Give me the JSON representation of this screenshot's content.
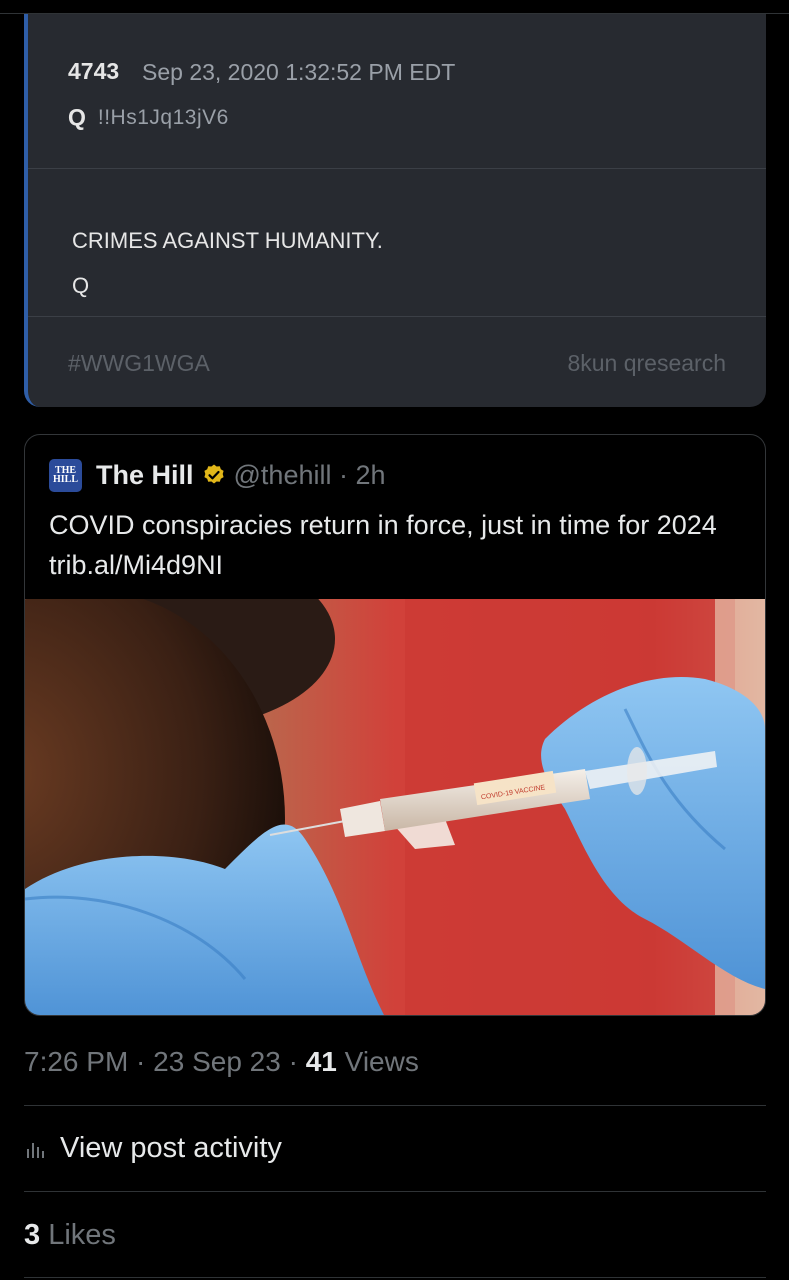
{
  "qdrop": {
    "number": "4743",
    "date": "Sep 23, 2020 1:32:52 PM EDT",
    "letter": "Q",
    "tripcode": "!!Hs1Jq13jV6",
    "body_line1": "CRIMES AGAINST HUMANITY.",
    "body_line2": "Q",
    "hashtag": "#WWG1WGA",
    "source": "8kun qresearch"
  },
  "quote": {
    "logo_top": "THE",
    "logo_bottom": "HILL",
    "name": "The Hill",
    "handle": "@thehill · 2h",
    "text": "COVID conspiracies return in force, just in time for 2024 trib.al/Mi4d9NI",
    "syringe_label": "COVID-19 VACCINE"
  },
  "post": {
    "time": "7:26 PM · 23 Sep 23 · ",
    "views_count": "41",
    "views_label": " Views",
    "activity_label": "View post activity",
    "likes_count": "3",
    "likes_label": " Likes"
  },
  "colors": {
    "background": "#000000",
    "card": "#272a30",
    "accent_bar": "#2f5ea8",
    "verified_gold": "#e2b719",
    "muted": "#71767b"
  },
  "icons": {
    "verified": "gold-check-badge-icon",
    "activity": "bar-chart-icon"
  }
}
